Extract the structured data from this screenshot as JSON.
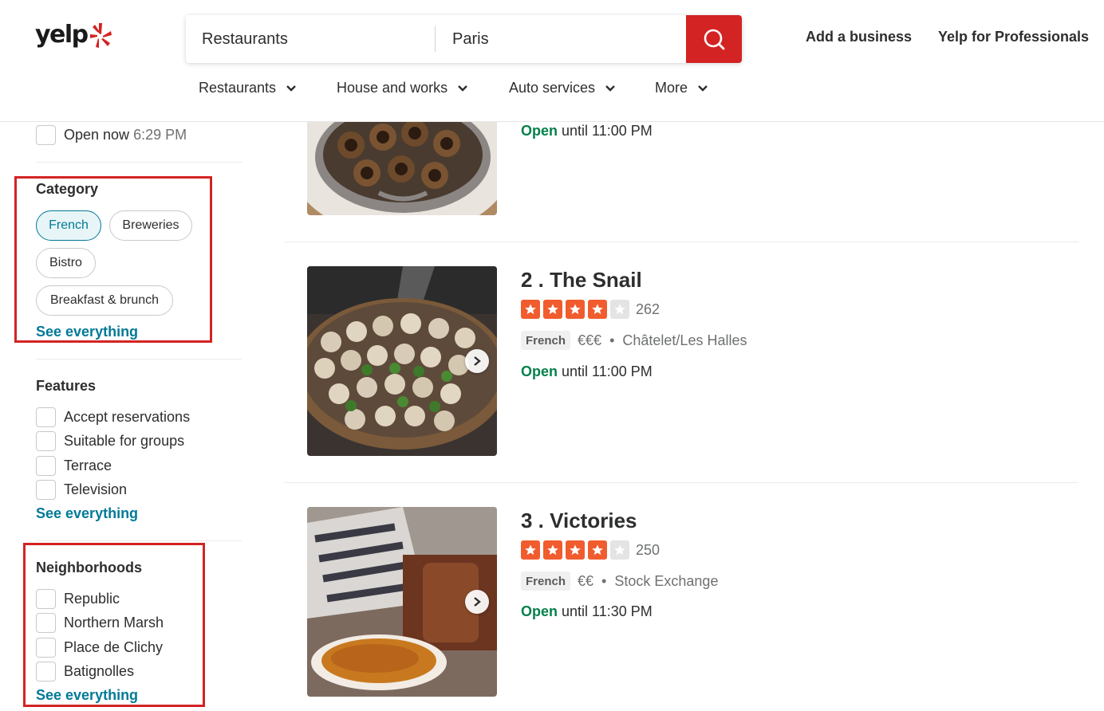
{
  "header": {
    "logo_text": "yelp",
    "search": {
      "find_value": "Restaurants",
      "near_value": "Paris"
    },
    "links": [
      "Add a business",
      "Yelp for Professionals"
    ]
  },
  "nav": [
    {
      "label": "Restaurants"
    },
    {
      "label": "House and works"
    },
    {
      "label": "Auto services"
    },
    {
      "label": "More"
    }
  ],
  "filters": {
    "open_now": {
      "label": "Open now",
      "time": "6:29 PM"
    },
    "category": {
      "title": "Category",
      "pills": [
        "French",
        "Breweries",
        "Bistro",
        "Breakfast & brunch"
      ],
      "active": "French",
      "see_all": "See everything"
    },
    "features": {
      "title": "Features",
      "items": [
        "Accept reservations",
        "Suitable for groups",
        "Terrace",
        "Television"
      ],
      "see_all": "See everything"
    },
    "neighborhoods": {
      "title": "Neighborhoods",
      "items": [
        "Republic",
        "Northern Marsh",
        "Place de Clichy",
        "Batignolles"
      ],
      "see_all": "See everything"
    }
  },
  "results": [
    {
      "open_label": "Open",
      "hours": "until 11:00 PM"
    },
    {
      "name": "2 . The Snail",
      "rating": 4,
      "reviews": "262",
      "tag": "French",
      "price": "€€€",
      "bullet": "•",
      "neighborhood": "Châtelet/Les Halles",
      "open_label": "Open",
      "hours": "until 11:00 PM"
    },
    {
      "name": "3 . Victories",
      "rating": 4,
      "reviews": "250",
      "tag": "French",
      "price": "€€",
      "bullet": "•",
      "neighborhood": "Stock Exchange",
      "open_label": "Open",
      "hours": "until 11:30 PM"
    }
  ],
  "colors": {
    "brand_red": "#d32323",
    "star_orange": "#f15c2f",
    "open_green": "#04804a",
    "link_teal": "#027a97"
  },
  "icons": [
    "yelp-burst-icon",
    "search-icon",
    "chevron-down-icon",
    "chevron-right-icon",
    "chevron-left-icon",
    "star-icon"
  ]
}
